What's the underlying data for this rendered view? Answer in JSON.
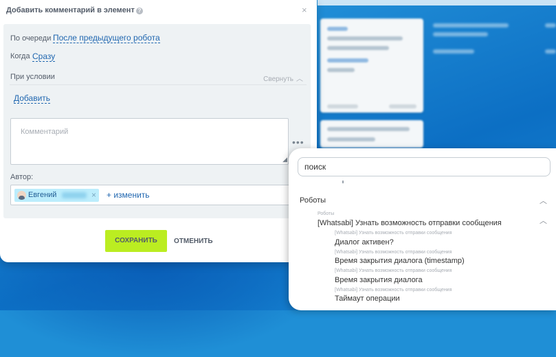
{
  "dialog": {
    "title": "Добавить комментарий в элемент",
    "help_icon": "?",
    "close_icon": "×",
    "queue_label": "По очереди",
    "queue_value": "После предыдущего робота",
    "when_label": "Когда",
    "when_value": "Сразу",
    "condition_label": "При условии",
    "collapse_label": "Свернуть",
    "add_link": "Добавить",
    "comment_placeholder": "Комментарий",
    "more_icon": "•••",
    "author_label": "Автор:",
    "author_name": "Евгений",
    "remove_icon": "×",
    "change_link": "+ изменить",
    "save_button": "СОХРАНИТЬ",
    "cancel_button": "ОТМЕНИТЬ"
  },
  "popup": {
    "search_value": "поиск",
    "section_title": "Роботы",
    "group_sub": "Роботы",
    "group_title": "[Whatsabi] Узнать возможность отправки сообщения",
    "items": [
      {
        "sub": "[Whatsabi] Узнать возможность отправки сообщения",
        "label": "Диалог активен?"
      },
      {
        "sub": "[Whatsabi] Узнать возможность отправки сообщения",
        "label": "Время закрытия диалога (timestamp)"
      },
      {
        "sub": "[Whatsabi] Узнать возможность отправки сообщения",
        "label": "Время закрытия диалога"
      },
      {
        "sub": "[Whatsabi] Узнать возможность отправки сообщения",
        "label": "Таймаут операции"
      }
    ],
    "chevron_icon": "chevron-up-icon"
  },
  "colors": {
    "accent_link": "#2067b0",
    "save_button": "#bbed21",
    "author_tag": "#bcedfc",
    "background": "#1a83d0"
  }
}
